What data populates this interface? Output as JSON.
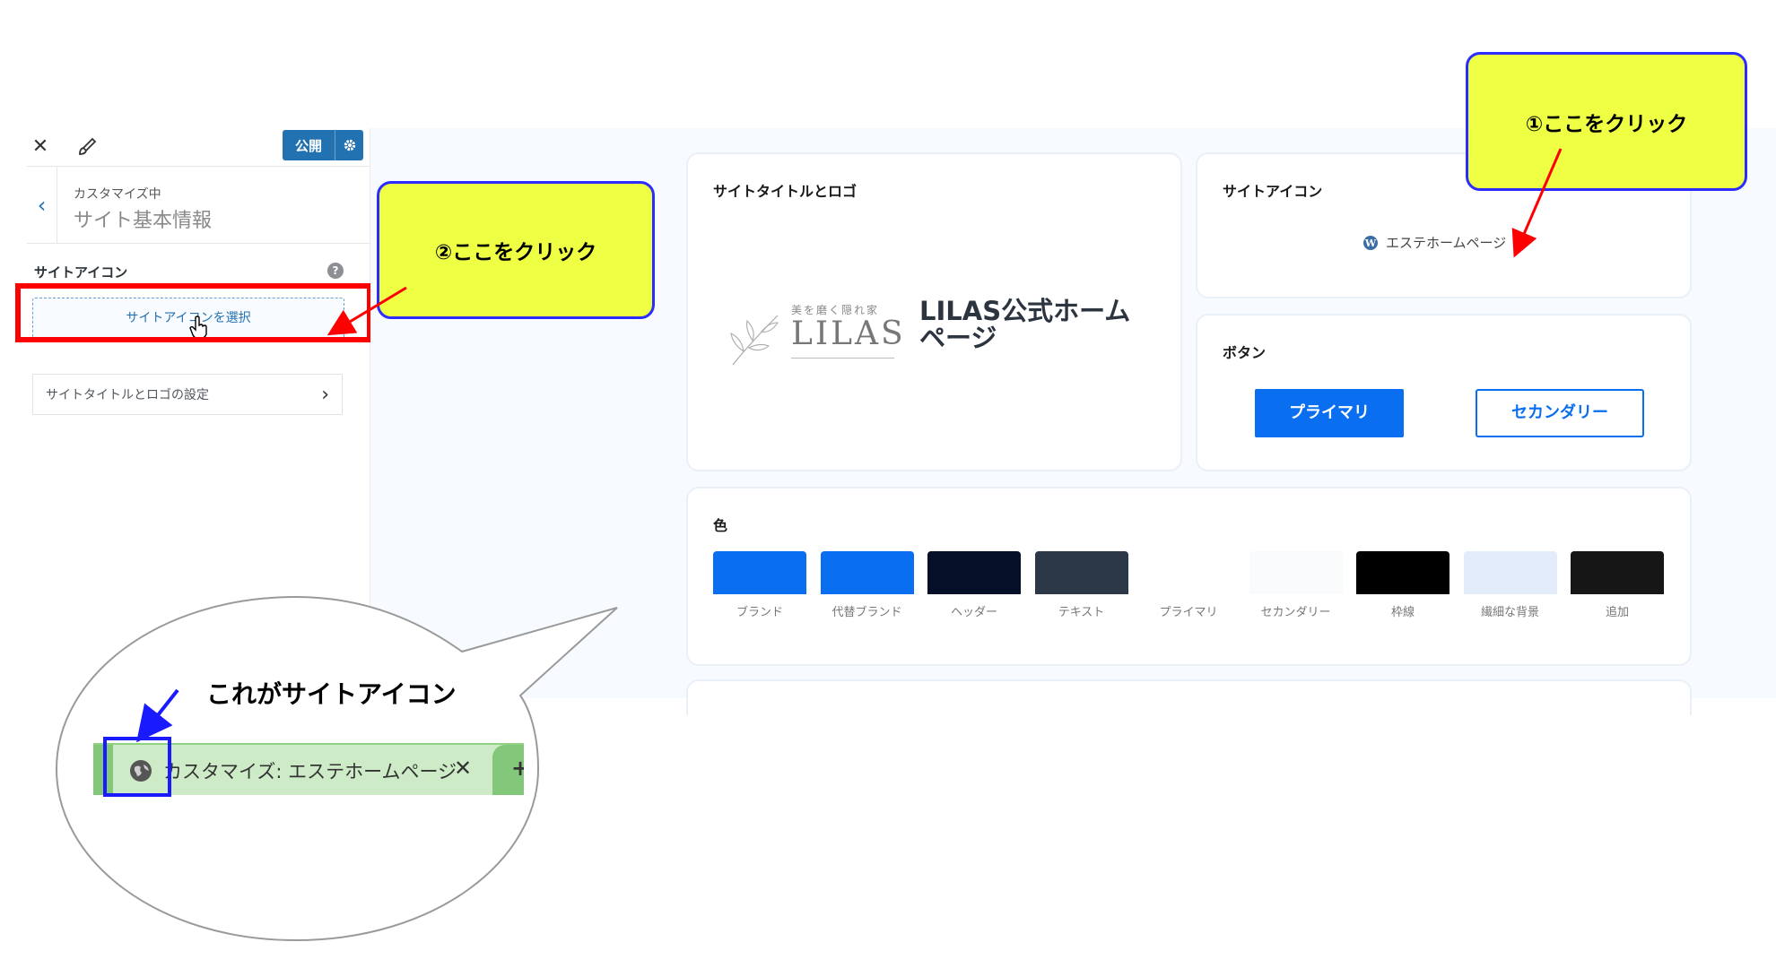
{
  "sidebar": {
    "close_glyph": "✕",
    "publish_label": "公開",
    "breadcrumb_sub": "カスタマイズ中",
    "breadcrumb_title": "サイト基本情報",
    "section_label": "サイトアイコン",
    "help_glyph": "?",
    "select_icon_label": "サイトアイコンを選択",
    "title_logo_label": "サイトタイトルとロゴの設定"
  },
  "preview": {
    "logo_card_title": "サイトタイトルとロゴ",
    "logo_tagline": "美を磨く隠れ家",
    "logo_word": "LILAS",
    "site_title": "LILAS公式ホームページ",
    "icon_card_title": "サイトアイコン",
    "icon_site_name": "エステホームページ",
    "button_card_title": "ボタン",
    "primary_button": "プライマリ",
    "secondary_button": "セカンダリー",
    "color_card_title": "色",
    "colors": [
      {
        "label": "ブランド",
        "hex": "#0a6ef0"
      },
      {
        "label": "代替ブランド",
        "hex": "#0a6ef0"
      },
      {
        "label": "ヘッダー",
        "hex": "#060f28"
      },
      {
        "label": "テキスト",
        "hex": "#2c3748"
      },
      {
        "label": "プライマリ",
        "hex": "#ffffff"
      },
      {
        "label": "セカンダリー",
        "hex": "#f9fbfd"
      },
      {
        "label": "枠線",
        "hex": "#000000"
      },
      {
        "label": "繊細な背景",
        "hex": "#e3ecfb"
      },
      {
        "label": "追加",
        "hex": "#161616"
      }
    ]
  },
  "annotations": {
    "callout_1": "①ここをクリック",
    "callout_2": "②ここをクリック",
    "bubble_caption": "これがサイトアイコン",
    "tab_title": "カスタマイズ: エステホームページ",
    "tab_close": "✕",
    "tab_plus": "+"
  },
  "colors": {
    "admin_blue": "#2271b1",
    "callout_fill": "#eeff44",
    "callout_border": "#2c2cff",
    "highlight_red": "#ff0000",
    "arrow_blue": "#1a1aff"
  },
  "icons": [
    "close-icon",
    "brush-icon",
    "gear-icon",
    "chevron-left-icon",
    "help-icon",
    "hand-cursor-icon",
    "chevron-right-icon",
    "wordpress-icon",
    "globe-icon",
    "leaf-icon"
  ]
}
